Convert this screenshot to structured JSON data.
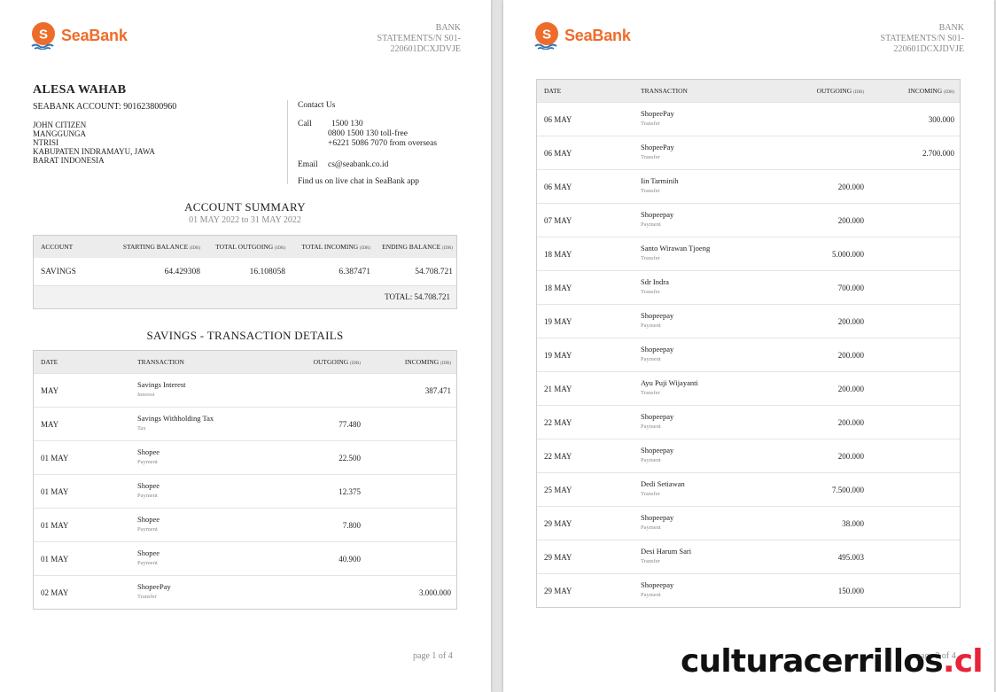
{
  "brand": {
    "name": "SeaBank",
    "accent": "#ee6c2b"
  },
  "statement": {
    "line1": "BANK",
    "line2": "STATEMENTS/N  S01-",
    "line3": "220601DCXJDVJE"
  },
  "customer": {
    "name": "ALESA WAHAB",
    "account": "SEABANK ACCOUNT: 901623800960",
    "address": [
      "JOHN CITIZEN",
      "MANGGUNGA",
      "NTRISI",
      "KABUPATEN INDRAMAYU, JAWA",
      "BARAT INDONESIA"
    ]
  },
  "contact": {
    "title": "Contact Us",
    "call_label": "Call",
    "call_lines": [
      "1500 130",
      "0800 1500 130 toll-free",
      "+6221 5086 7070 from overseas"
    ],
    "email_label": "Email",
    "email": "cs@seabank.co.id",
    "chat": "Find us on live chat in SeaBank app"
  },
  "summary": {
    "title": "ACCOUNT SUMMARY",
    "period": "01 MAY 2022 to 31 MAY 2022",
    "headers": {
      "account": "ACCOUNT",
      "starting": "STARTING BALANCE",
      "outgoing": "TOTAL OUTGOING",
      "incoming": "TOTAL INCOMING",
      "ending": "ENDING BALANCE",
      "unit": "(IDR)"
    },
    "row": {
      "account": "SAVINGS",
      "starting": "64.429308",
      "outgoing": "16.108058",
      "incoming": "6.387471",
      "ending": "54.708.721"
    },
    "total": "TOTAL: 54.708.721"
  },
  "details_title": "SAVINGS - TRANSACTION DETAILS",
  "table_headers": {
    "date": "DATE",
    "transaction": "TRANSACTION",
    "outgoing": "OUTGOING",
    "incoming": "INCOMING",
    "unit": "(IDR)"
  },
  "page1_transactions": [
    {
      "date": "MAY",
      "name": "Savings  Interest",
      "type": "Interest",
      "outgoing": "",
      "incoming": "387.471"
    },
    {
      "date": "MAY",
      "name": "Savings Withholding Tax",
      "type": "Tax",
      "outgoing": "77.480",
      "incoming": ""
    },
    {
      "date": "01 MAY",
      "name": "Shopee",
      "type": "Payment",
      "outgoing": "22.500",
      "incoming": ""
    },
    {
      "date": "01 MAY",
      "name": "Shopee",
      "type": "Payment",
      "outgoing": "12.375",
      "incoming": ""
    },
    {
      "date": "01 MAY",
      "name": "Shopee",
      "type": "Payment",
      "outgoing": "7.800",
      "incoming": ""
    },
    {
      "date": "01 MAY",
      "name": "Shopee",
      "type": "Payment",
      "outgoing": "40.900",
      "incoming": ""
    },
    {
      "date": "02 MAY",
      "name": "ShopeePay",
      "type": "Transfer",
      "outgoing": "",
      "incoming": "3.000.000"
    }
  ],
  "page2_transactions": [
    {
      "date": "06 MAY",
      "name": "ShopeePay",
      "type": "Transfer",
      "outgoing": "",
      "incoming": "300.000"
    },
    {
      "date": "06 MAY",
      "name": "ShopeePay",
      "type": "Transfer",
      "outgoing": "",
      "incoming": "2.700.000"
    },
    {
      "date": "06 MAY",
      "name": "Iin Tarminih",
      "type": "Transfer",
      "outgoing": "200.000",
      "incoming": ""
    },
    {
      "date": "07 MAY",
      "name": "Shopeepay",
      "type": "Payment",
      "outgoing": "200.000",
      "incoming": ""
    },
    {
      "date": "18 MAY",
      "name": "Santo Wirawan Tjoeng",
      "type": "Transfer",
      "outgoing": "5.000.000",
      "incoming": ""
    },
    {
      "date": "18 MAY",
      "name": "Sdr Indra",
      "type": "Transfer",
      "outgoing": "700.000",
      "incoming": ""
    },
    {
      "date": "19 MAY",
      "name": "Shopeepay",
      "type": "Payment",
      "outgoing": "200.000",
      "incoming": ""
    },
    {
      "date": "19 MAY",
      "name": "Shopeepay",
      "type": "Payment",
      "outgoing": "200.000",
      "incoming": ""
    },
    {
      "date": "21 MAY",
      "name": "Ayu Puji Wijayanti",
      "type": "Transfer",
      "outgoing": "200.000",
      "incoming": ""
    },
    {
      "date": "22 MAY",
      "name": "Shopeepay",
      "type": "Payment",
      "outgoing": "200.000",
      "incoming": ""
    },
    {
      "date": "22 MAY",
      "name": "Shopeepay",
      "type": "Payment",
      "outgoing": "200.000",
      "incoming": ""
    },
    {
      "date": "25 MAY",
      "name": "Dedi Setiawan",
      "type": "Transfer",
      "outgoing": "7.500.000",
      "incoming": ""
    },
    {
      "date": "29 MAY",
      "name": "Shopeepay",
      "type": "Payment",
      "outgoing": "38.000",
      "incoming": ""
    },
    {
      "date": "29 MAY",
      "name": "Desi Harum Sari",
      "type": "Transfer",
      "outgoing": "495.003",
      "incoming": ""
    },
    {
      "date": "29 MAY",
      "name": "Shopeepay",
      "type": "Payment",
      "outgoing": "150.000",
      "incoming": ""
    }
  ],
  "page1_number": "page 1 of 4",
  "page2_number": "page 2 of 4",
  "watermark": {
    "main": "culturacerrillos",
    "tld": ".cl",
    "tld_color": "#e8243a"
  }
}
